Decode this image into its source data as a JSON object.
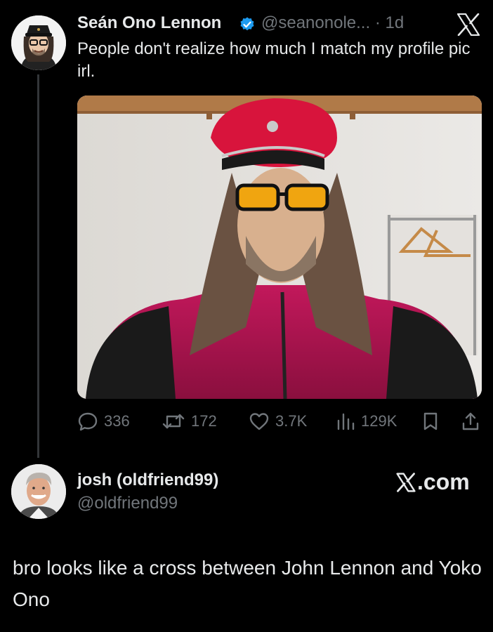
{
  "tweet": {
    "author_name": "Seán Ono Lennon",
    "author_handle": "@seanonole...",
    "time": "· 1d",
    "text": "People don't realize how much I match my profile pic irl.",
    "stats": {
      "replies": "336",
      "retweets": "172",
      "likes": "3.7K",
      "views": "129K"
    },
    "accent_color": "#1d9bf0"
  },
  "reply": {
    "author_name": "josh (oldfriend99)",
    "author_handle": "@oldfriend99",
    "brand": ".com",
    "comment": "bro looks like a cross between John Lennon and Yoko Ono"
  },
  "icons": [
    "x-logo-icon",
    "verified-badge-icon",
    "reply-icon",
    "retweet-icon",
    "like-icon",
    "views-icon",
    "bookmark-icon",
    "share-icon"
  ]
}
